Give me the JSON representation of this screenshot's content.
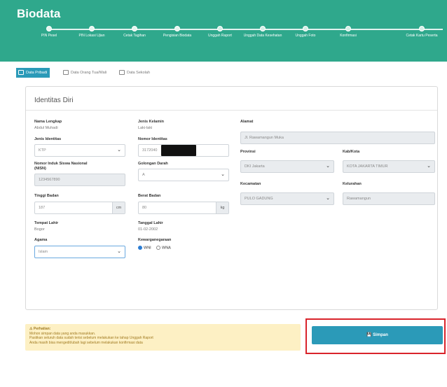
{
  "app": {
    "title": "Biodata"
  },
  "steps": [
    "PIN Pesel",
    "PIN Lokasi Ujian",
    "Cetak Tagihan",
    "Pengisian Biodata",
    "Unggah Raport",
    "Unggah Data Kesehatan",
    "Unggah Foto",
    "Konfirmasi",
    "Cetak Kartu Peserta"
  ],
  "tabs": {
    "t1": "Data Pribadi",
    "t2": "Data Orang Tua/Wali",
    "t3": "Data Sekolah"
  },
  "card": {
    "title": "Identitas Diri"
  },
  "form": {
    "nama_label": "Nama Lengkap",
    "nama_value": "Abdul Muhadi",
    "jenis_identitas_label": "Jenis Identitas",
    "jenis_identitas_value": "KTP",
    "nisn_label_1": "Nomor Induk Siswa Nasional",
    "nisn_label_2": "(NISN)",
    "nisn_value": "1234567890",
    "tinggi_label": "Tinggi Badan",
    "tinggi_value": "187",
    "tinggi_unit": "cm",
    "tempat_label": "Tempat Lahir",
    "tempat_value": "Bogor",
    "agama_label": "Agama",
    "agama_value": "Islam",
    "jk_label": "Jenis Kelamin",
    "jk_value": "Laki-laki",
    "nomor_identitas_label": "Nomor Identitas",
    "nomor_identitas_value": "3172040",
    "goldar_label": "Golongan Darah",
    "goldar_value": "A",
    "berat_label": "Berat Badan",
    "berat_value": "80",
    "berat_unit": "kg",
    "tgl_label": "Tanggal Lahir",
    "tgl_value": "01-02-2002",
    "kwn_label": "Kewarganegaraan",
    "kwn_wni": "WNI",
    "kwn_wna": "WNA",
    "alamat_label": "Alamat",
    "alamat_value": "Jl. Rawamangun Muka",
    "provinsi_label": "Provinsi",
    "provinsi_value": "DKI Jakarta",
    "kabkota_label": "Kab/Kota",
    "kabkota_value": "KOTA JAKARTA TIMUR",
    "kecamatan_label": "Kecamatan",
    "kecamatan_value": "PULO GADUNG",
    "kelurahan_label": "Kelurahan",
    "kelurahan_value": "Rawamangun"
  },
  "warning": {
    "title": "Perhatian:",
    "line1": "Mohon simpan data yang anda masukkan.",
    "line2": "Pastikan seluruh data sudah terisi sebelum melakukan ke tahap Unggah Raport",
    "line3": "Anda masih bisa mengedit/ubah lagi sebelum melakukan konfirmasi data"
  },
  "actions": {
    "save": "Simpan"
  }
}
